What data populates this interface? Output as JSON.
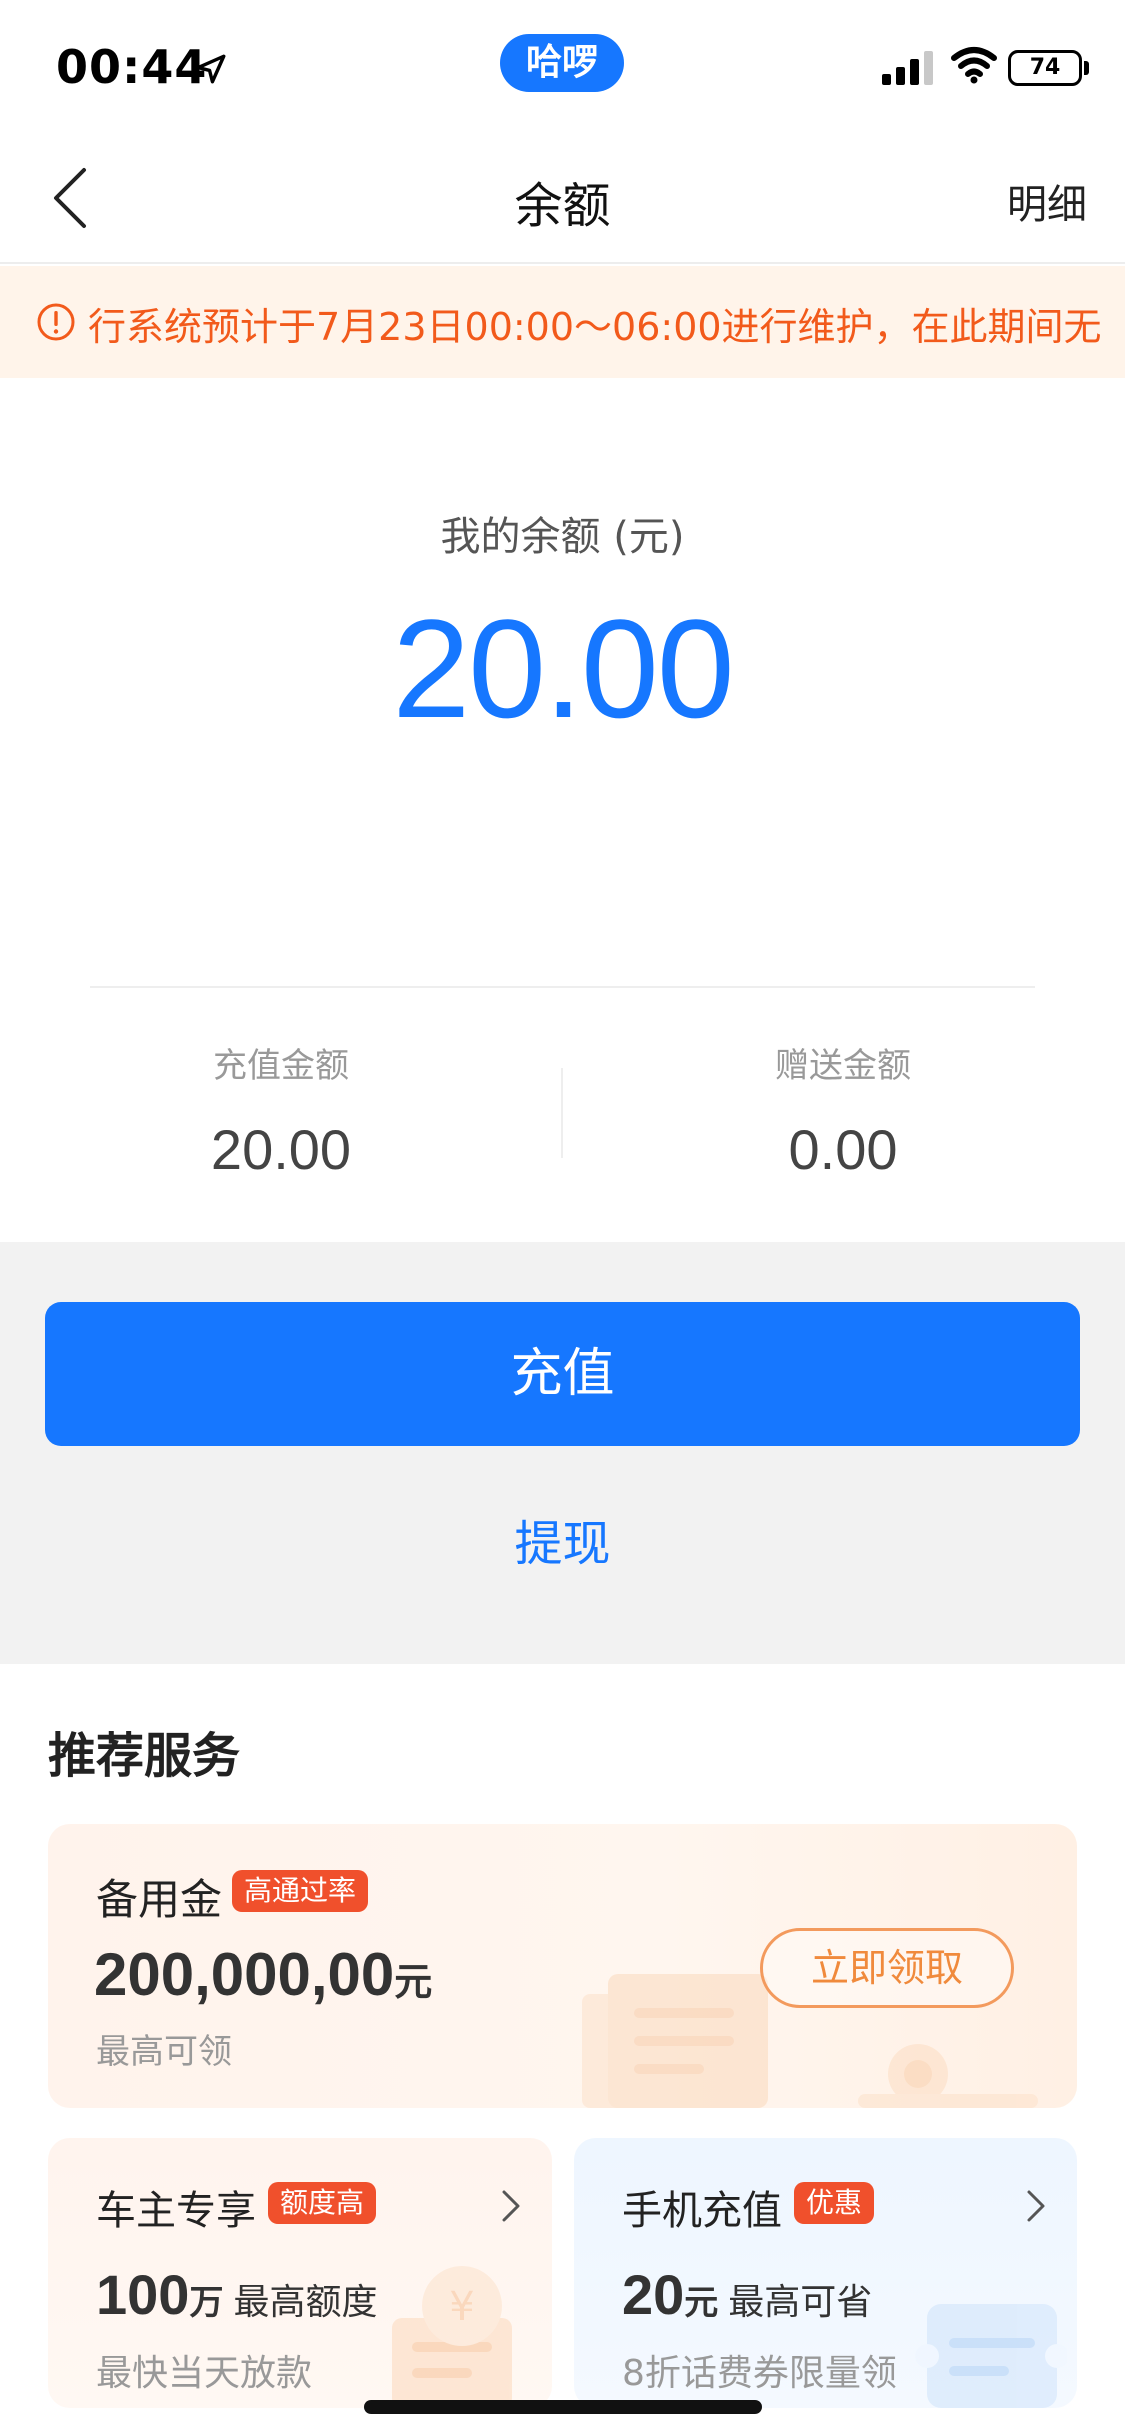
{
  "status_bar": {
    "time": "00:44",
    "app_pill": "哈啰",
    "battery": "74"
  },
  "nav": {
    "title": "余额",
    "detail_link": "明细"
  },
  "notice": {
    "text": "行系统预计于7月23日00:00～06:00进行维护，在此期间无"
  },
  "balance": {
    "label": "我的余额 (元)",
    "amount": "20.00",
    "recharge_label": "充值金额",
    "recharge_value": "20.00",
    "gift_label": "赠送金额",
    "gift_value": "0.00"
  },
  "actions": {
    "recharge_button": "充值",
    "withdraw_link": "提现"
  },
  "recommend": {
    "title": "推荐服务",
    "card_reserve": {
      "title": "备用金",
      "badge": "高通过率",
      "amount": "200,000,00",
      "unit": "元",
      "sub": "最高可领",
      "button": "立即领取"
    },
    "card_owner": {
      "title": "车主专享",
      "badge": "额度高",
      "amount": "100",
      "unit": "万",
      "desc": "最高额度",
      "sub": "最快当天放款"
    },
    "card_phone": {
      "title": "手机充值",
      "badge": "优惠",
      "amount": "20",
      "unit": "元",
      "desc": "最高可省",
      "sub": "8折话费券限量领"
    }
  },
  "colors": {
    "primary": "#1677ff",
    "notice_text": "#f25a1b",
    "notice_bg": "#fff4ea",
    "badge": "#f0502c",
    "claim_border": "#f39a5d"
  }
}
